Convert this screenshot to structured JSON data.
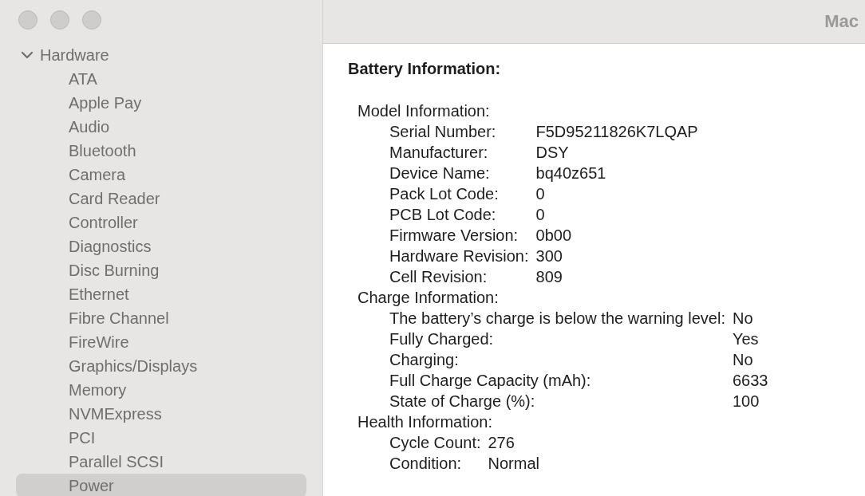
{
  "window": {
    "title": "Mac"
  },
  "sidebar": {
    "group": {
      "label": "Hardware",
      "expanded": true,
      "items": [
        {
          "label": "ATA",
          "selected": false
        },
        {
          "label": "Apple Pay",
          "selected": false
        },
        {
          "label": "Audio",
          "selected": false
        },
        {
          "label": "Bluetooth",
          "selected": false
        },
        {
          "label": "Camera",
          "selected": false
        },
        {
          "label": "Card Reader",
          "selected": false
        },
        {
          "label": "Controller",
          "selected": false
        },
        {
          "label": "Diagnostics",
          "selected": false
        },
        {
          "label": "Disc Burning",
          "selected": false
        },
        {
          "label": "Ethernet",
          "selected": false
        },
        {
          "label": "Fibre Channel",
          "selected": false
        },
        {
          "label": "FireWire",
          "selected": false
        },
        {
          "label": "Graphics/Displays",
          "selected": false
        },
        {
          "label": "Memory",
          "selected": false
        },
        {
          "label": "NVMExpress",
          "selected": false
        },
        {
          "label": "PCI",
          "selected": false
        },
        {
          "label": "Parallel SCSI",
          "selected": false
        },
        {
          "label": "Power",
          "selected": true
        }
      ]
    }
  },
  "content": {
    "heading": "Battery Information:",
    "sections": [
      {
        "title": "Model Information:",
        "rows": [
          {
            "label": "Serial Number:",
            "value": "F5D95211826K7LQAP"
          },
          {
            "label": "Manufacturer:",
            "value": "DSY"
          },
          {
            "label": "Device Name:",
            "value": "bq40z651"
          },
          {
            "label": "Pack Lot Code:",
            "value": "0"
          },
          {
            "label": "PCB Lot Code:",
            "value": "0"
          },
          {
            "label": "Firmware Version:",
            "value": "0b00"
          },
          {
            "label": "Hardware Revision:",
            "value": "300"
          },
          {
            "label": "Cell Revision:",
            "value": "809"
          }
        ]
      },
      {
        "title": "Charge Information:",
        "rows": [
          {
            "label": "The battery’s charge is below the warning level:",
            "value": "No"
          },
          {
            "label": "Fully Charged:",
            "value": "Yes"
          },
          {
            "label": "Charging:",
            "value": "No"
          },
          {
            "label": "Full Charge Capacity (mAh):",
            "value": "6633"
          },
          {
            "label": "State of Charge (%):",
            "value": "100"
          }
        ]
      },
      {
        "title": "Health Information:",
        "rows": [
          {
            "label": "Cycle Count:",
            "value": "276"
          },
          {
            "label": "Condition:",
            "value": "Normal"
          }
        ]
      }
    ]
  }
}
